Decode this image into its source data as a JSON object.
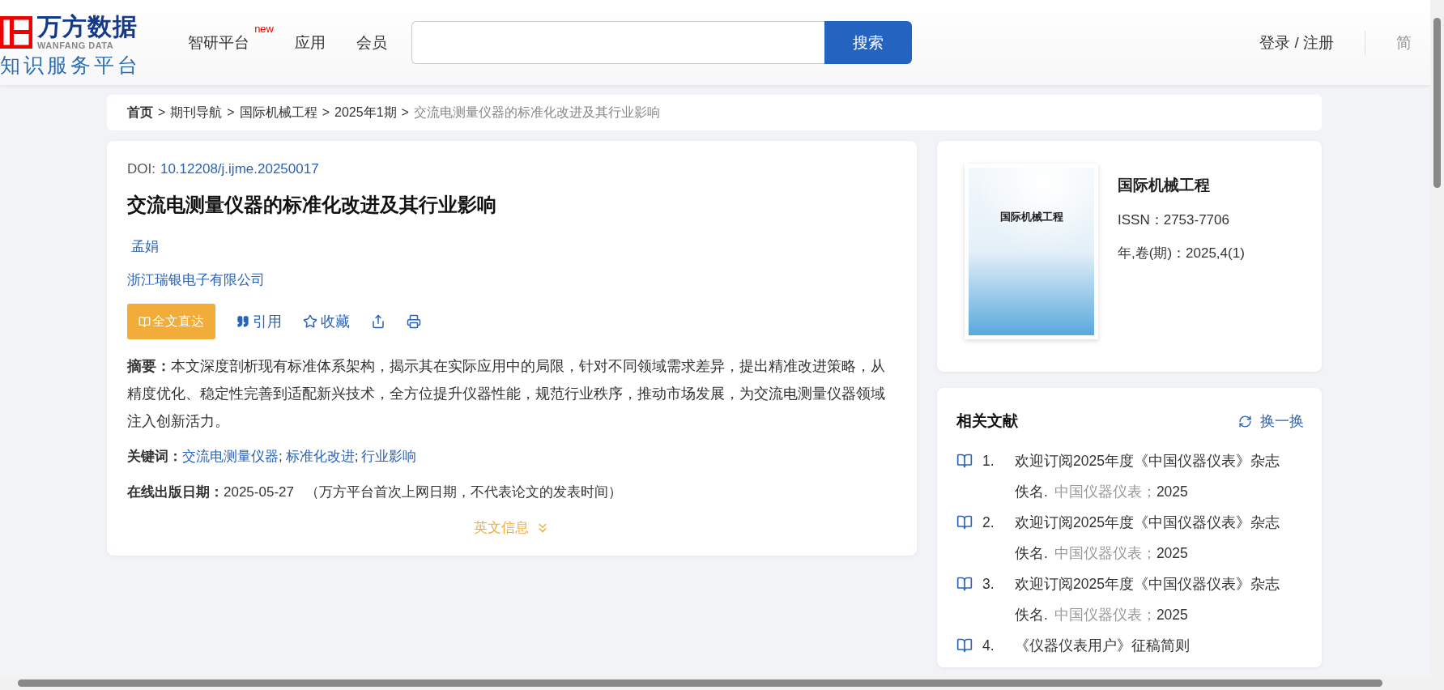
{
  "header": {
    "logo": {
      "name": "万方数据",
      "name_en": "WANFANG DATA",
      "tagline": "知识服务平台"
    },
    "nav": [
      {
        "label": "智研平台",
        "badge": "new"
      },
      {
        "label": "应用"
      },
      {
        "label": "会员"
      }
    ],
    "search": {
      "button": "搜索"
    },
    "login": "登录 / 注册",
    "language": "简"
  },
  "breadcrumb": {
    "separator": ">",
    "items": [
      {
        "label": "首页",
        "current": false,
        "bold": true
      },
      {
        "label": "期刊导航",
        "current": false,
        "bold": false
      },
      {
        "label": "国际机械工程",
        "current": false,
        "bold": false
      },
      {
        "label": "2025年1期",
        "current": false,
        "bold": false
      },
      {
        "label": "交流电测量仪器的标准化改进及其行业影响",
        "current": true,
        "bold": false
      }
    ]
  },
  "article": {
    "doi_label": "DOI:",
    "doi": "10.12208/j.ijme.20250017",
    "title": "交流电测量仪器的标准化改进及其行业影响",
    "authors": [
      "孟娟"
    ],
    "affiliation": "浙江瑞银电子有限公司",
    "actions": [
      {
        "kind": "fulltext",
        "label": "全文直达"
      },
      {
        "kind": "cite",
        "label": "引用"
      },
      {
        "kind": "favorite",
        "label": "收藏"
      },
      {
        "kind": "share"
      },
      {
        "kind": "print"
      }
    ],
    "abstract": {
      "label": "摘要：",
      "text": "本文深度剖析现有标准体系架构，揭示其在实际应用中的局限，针对不同领域需求差异，提出精准改进策略，从精度优化、稳定性完善到适配新兴技术，全方位提升仪器性能，规范行业秩序，推动市场发展，为交流电测量仪器领域注入创新活力。"
    },
    "keywords": {
      "label": "关键词：",
      "separator": ";",
      "items": [
        "交流电测量仪器",
        "标准化改进",
        "行业影响"
      ]
    },
    "online_date": {
      "label": "在线出版日期：",
      "value": "2025-05-27",
      "note": "（万方平台首次上网日期，不代表论文的发表时间）"
    },
    "expand": "英文信息"
  },
  "journal": {
    "cover_title": "国际机械工程",
    "name": "国际机械工程",
    "issn_label": "ISSN：",
    "issn": "2753-7706",
    "volume_label": "年,卷(期)：",
    "volume": "2025,4(1)"
  },
  "related": {
    "title": "相关文献",
    "refresh": "换一换",
    "items": [
      {
        "number": "1.",
        "title": "欢迎订阅2025年度《中国仪器仪表》杂志",
        "author": "佚名.",
        "source": "中国仪器仪表；",
        "year": "2025"
      },
      {
        "number": "2.",
        "title": "欢迎订阅2025年度《中国仪器仪表》杂志",
        "author": "佚名.",
        "source": "中国仪器仪表；",
        "year": "2025"
      },
      {
        "number": "3.",
        "title": "欢迎订阅2025年度《中国仪器仪表》杂志",
        "author": "佚名.",
        "source": "中国仪器仪表；",
        "year": "2025"
      },
      {
        "number": "4.",
        "title": "《仪器仪表用户》征稿简则"
      }
    ]
  }
}
